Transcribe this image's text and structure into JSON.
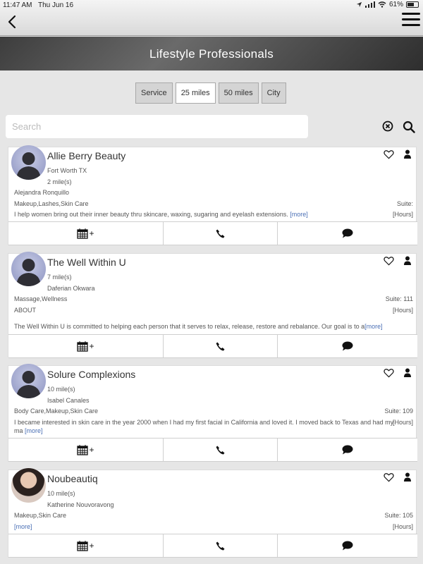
{
  "status": {
    "time": "11:47 AM",
    "date": "Thu Jun 16",
    "battery": "61%"
  },
  "header": {
    "title": "Lifestyle Professionals"
  },
  "filters": [
    {
      "label": "Service",
      "active": false
    },
    {
      "label": "25 miles",
      "active": true
    },
    {
      "label": "50 miles",
      "active": false
    },
    {
      "label": "City",
      "active": false
    }
  ],
  "search": {
    "placeholder": "Search",
    "value": ""
  },
  "listings": [
    {
      "name": "Allie Berry Beauty",
      "location": "Fort Worth TX",
      "distance": "2 mile(s)",
      "contact": "Alejandra Ronquillo",
      "services": "Makeup,Lashes,Skin Care",
      "suite": "Suite:",
      "hours": "[Hours]",
      "description": "I help women bring out their inner beauty thru skincare, waxing, sugaring and eyelash extensions.",
      "more": "[more]"
    },
    {
      "name": "The Well Within U",
      "distance": "7 mile(s)",
      "contact": "Daferian Okwara",
      "services": "Massage,Wellness",
      "suite": "Suite: 111",
      "about": "ABOUT",
      "hours": "[Hours]",
      "description": "The Well Within U is committed to helping each person that it serves to relax, release, restore and rebalance. Our goal is to a",
      "more": "[more]"
    },
    {
      "name": "Solure Complexions",
      "distance": "10 mile(s)",
      "contact": "Isabel Canales",
      "services": "Body Care,Makeup,Skin Care",
      "suite": "Suite: 109",
      "hours": "[Hours]",
      "description_line1": "I became interested in skin care in the year 2000 when I had my first facial in California and loved it. I moved back to Texas and had my",
      "description_line2": "ma",
      "more": "[more]"
    },
    {
      "name": "Noubeautiq",
      "distance": "10 mile(s)",
      "contact": "Katherine Nouvoravong",
      "services": "Makeup,Skin Care",
      "suite": "Suite: 105",
      "hours": "[Hours]",
      "more": "[more]"
    }
  ],
  "colors": {
    "link": "#4a6fb5",
    "titlebar": "#3d3d3d",
    "background": "#e6e6e6"
  },
  "icons": [
    "back-chevron-icon",
    "hamburger-menu-icon",
    "clear-icon",
    "search-icon",
    "heart-icon",
    "person-icon",
    "calendar-add-icon",
    "phone-icon",
    "chat-bubble-icon"
  ]
}
